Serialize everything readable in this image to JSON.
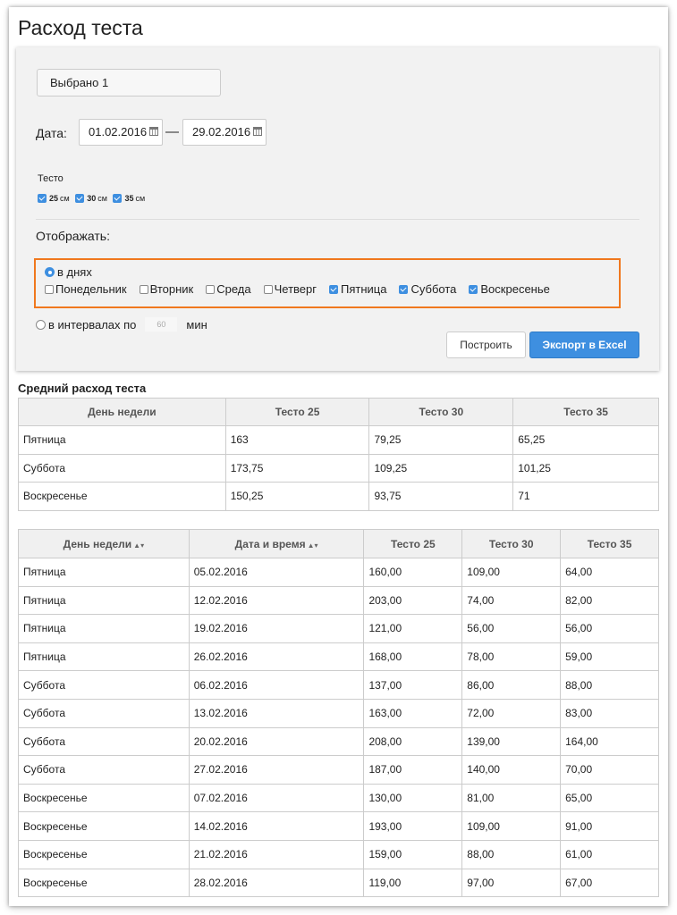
{
  "page": {
    "title": "Расход теста"
  },
  "filters": {
    "selected_text": "Выбрано 1",
    "date_label": "Дата:",
    "date_from": "01.02.2016",
    "date_separator": "—",
    "date_to": "29.02.2016",
    "dough_label": "Тесто",
    "dough_options": [
      {
        "value": "25",
        "unit": "см",
        "checked": true
      },
      {
        "value": "30",
        "unit": "см",
        "checked": true
      },
      {
        "value": "35",
        "unit": "см",
        "checked": true
      }
    ],
    "display_label": "Отображать:",
    "by_days_label": "в днях",
    "weekdays": [
      {
        "label": "Понедельник",
        "checked": false
      },
      {
        "label": "Вторник",
        "checked": false
      },
      {
        "label": "Среда",
        "checked": false
      },
      {
        "label": "Четверг",
        "checked": false
      },
      {
        "label": "Пятница",
        "checked": true
      },
      {
        "label": "Суббота",
        "checked": true
      },
      {
        "label": "Воскресенье",
        "checked": true
      }
    ],
    "interval_label": "в интервалах по",
    "interval_value": "60",
    "interval_unit": "мин",
    "build_button": "Построить",
    "export_button": "Экспорт в Excel"
  },
  "summary": {
    "title": "Средний расход теста",
    "headers": [
      "День недели",
      "Тесто 25",
      "Тесто 30",
      "Тесто 35"
    ],
    "rows": [
      [
        "Пятница",
        "163",
        "79,25",
        "65,25"
      ],
      [
        "Суббота",
        "173,75",
        "109,25",
        "101,25"
      ],
      [
        "Воскресенье",
        "150,25",
        "93,75",
        "71"
      ]
    ]
  },
  "details": {
    "headers": [
      "День недели",
      "Дата и время",
      "Тесто 25",
      "Тесто 30",
      "Тесто 35"
    ],
    "sort_glyph": "▲▾",
    "rows": [
      [
        "Пятница",
        "05.02.2016",
        "160,00",
        "109,00",
        "64,00"
      ],
      [
        "Пятница",
        "12.02.2016",
        "203,00",
        "74,00",
        "82,00"
      ],
      [
        "Пятница",
        "19.02.2016",
        "121,00",
        "56,00",
        "56,00"
      ],
      [
        "Пятница",
        "26.02.2016",
        "168,00",
        "78,00",
        "59,00"
      ],
      [
        "Суббота",
        "06.02.2016",
        "137,00",
        "86,00",
        "88,00"
      ],
      [
        "Суббота",
        "13.02.2016",
        "163,00",
        "72,00",
        "83,00"
      ],
      [
        "Суббота",
        "20.02.2016",
        "208,00",
        "139,00",
        "164,00"
      ],
      [
        "Суббота",
        "27.02.2016",
        "187,00",
        "140,00",
        "70,00"
      ],
      [
        "Воскресенье",
        "07.02.2016",
        "130,00",
        "81,00",
        "65,00"
      ],
      [
        "Воскресенье",
        "14.02.2016",
        "193,00",
        "109,00",
        "91,00"
      ],
      [
        "Воскресенье",
        "21.02.2016",
        "159,00",
        "88,00",
        "61,00"
      ],
      [
        "Воскресенье",
        "28.02.2016",
        "119,00",
        "97,00",
        "67,00"
      ]
    ]
  },
  "colors": {
    "accent": "#3e8fe0",
    "highlight": "#f0781e"
  }
}
